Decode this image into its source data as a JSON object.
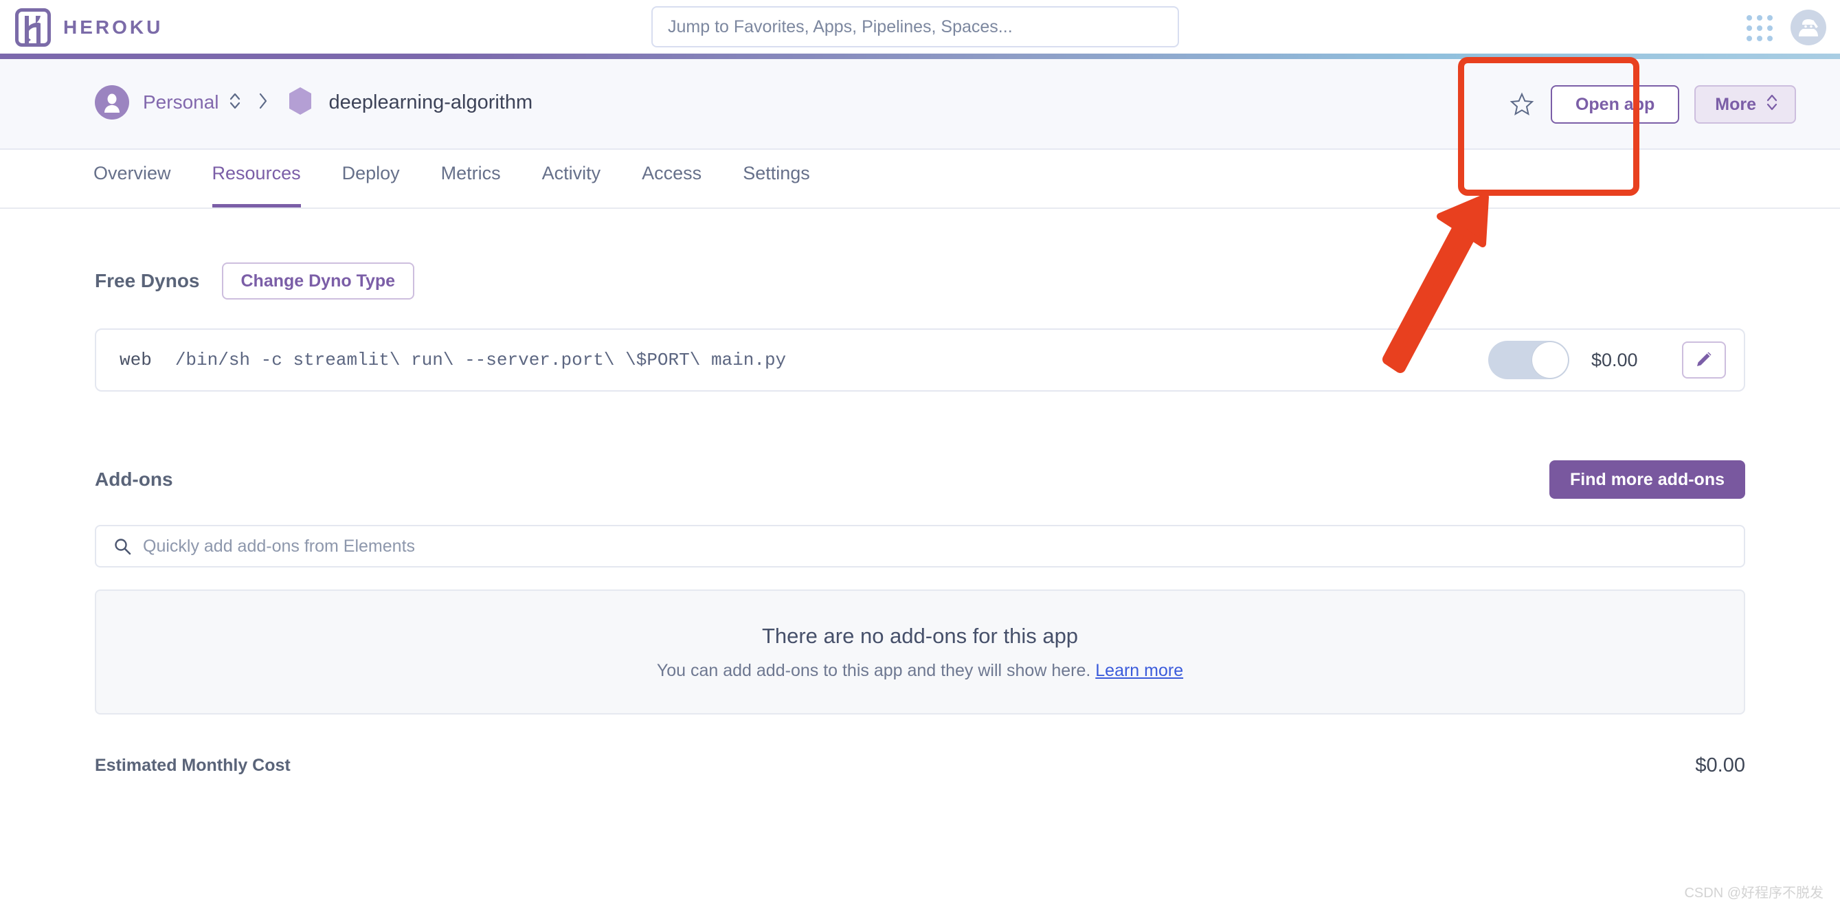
{
  "header": {
    "brand_name": "HEROKU",
    "logo_icon": "heroku-logo-icon",
    "search_placeholder": "Jump to Favorites, Apps, Pipelines, Spaces...",
    "search_value": "",
    "app_grid_icon": "app-grid-icon",
    "avatar_icon": "ninja-avatar-icon"
  },
  "appbar": {
    "owner": "Personal",
    "owner_switch_icon": "chevron-updown-icon",
    "separator": "›",
    "app_name": "deeplearning-algorithm",
    "app_icon": "hexagon-app-icon",
    "favorite_icon": "star-outline-icon",
    "open_app_label": "Open app",
    "more_label": "More",
    "more_icon": "chevron-updown-icon"
  },
  "tabs": [
    {
      "label": "Overview",
      "active": false
    },
    {
      "label": "Resources",
      "active": true
    },
    {
      "label": "Deploy",
      "active": false
    },
    {
      "label": "Metrics",
      "active": false
    },
    {
      "label": "Activity",
      "active": false
    },
    {
      "label": "Access",
      "active": false
    },
    {
      "label": "Settings",
      "active": false
    }
  ],
  "dynos": {
    "section_title": "Free Dynos",
    "change_type_label": "Change Dyno Type",
    "row": {
      "type": "web",
      "command": "/bin/sh -c streamlit\\ run\\ --server.port\\ \\$PORT\\ main.py",
      "toggle_state": "on",
      "price": "$0.00",
      "edit_icon": "pencil-edit-icon"
    }
  },
  "addons": {
    "section_title": "Add-ons",
    "find_more_label": "Find more add-ons",
    "search_placeholder": "Quickly add add-ons from Elements",
    "search_value": "",
    "search_icon": "search-icon",
    "empty_title": "There are no add-ons for this app",
    "empty_subtitle": "You can add add-ons to this app and they will show here.",
    "empty_link": "Learn more"
  },
  "cost": {
    "label": "Estimated Monthly Cost",
    "value": "$0.00"
  },
  "annotations": {
    "highlight_box": "open-app-highlight",
    "arrow": "pointer-arrow",
    "color": "#e8401f"
  },
  "watermark": "CSDN @好程序不脱发",
  "colors": {
    "brand_purple": "#7b6ba8",
    "accent_purple": "#7b5ea7",
    "solid_purple": "#79589f",
    "link_blue": "#3b5bdb",
    "annotation_red": "#e8401f"
  }
}
